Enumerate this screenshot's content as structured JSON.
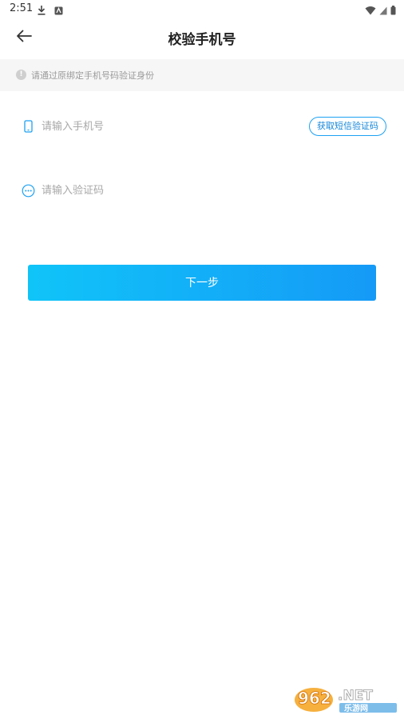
{
  "status_bar": {
    "time": "2:51",
    "left_icons": [
      "download-icon",
      "app-notification-icon"
    ],
    "right_icons": [
      "wifi-icon",
      "cellular-signal-icon",
      "battery-icon"
    ]
  },
  "nav": {
    "title": "校验手机号",
    "back_icon": "arrow-left-icon"
  },
  "tip": {
    "icon": "info-icon",
    "icon_glyph": "!",
    "text": "请通过原绑定手机号码验证身份"
  },
  "phone_field": {
    "icon": "phone-icon",
    "placeholder": "请输入手机号",
    "value": ""
  },
  "sms_button": {
    "label": "获取短信验证码"
  },
  "code_field": {
    "icon": "message-dots-icon",
    "placeholder": "请输入验证码",
    "value": ""
  },
  "next_button": {
    "label": "下一步"
  },
  "watermark": {
    "brand": "962.NET",
    "subtitle": "乐游网"
  },
  "colors": {
    "accent": "#1da1f2",
    "button_start": "#10c4f8",
    "button_end": "#159af7",
    "tip_background": "#f6f6f6"
  }
}
